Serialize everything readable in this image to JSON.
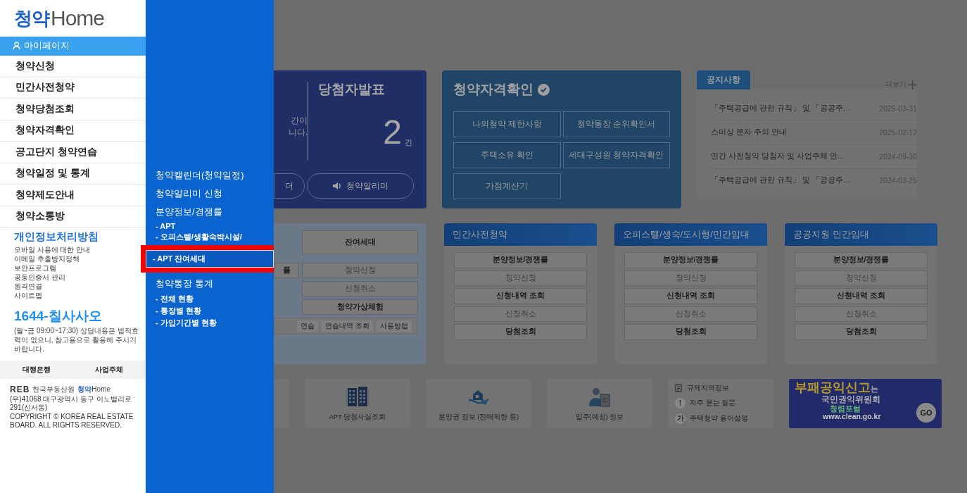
{
  "logo": {
    "mark": "청약",
    "word": "Home"
  },
  "sidebar": {
    "items": [
      {
        "label": "마이페이지",
        "selected": true
      },
      {
        "label": "청약신청",
        "selected": false
      },
      {
        "label": "민간사전청약",
        "selected": false
      },
      {
        "label": "청약당첨조회",
        "selected": false
      },
      {
        "label": "청약자격확인",
        "selected": false
      },
      {
        "label": "공고단지 청약연습",
        "selected": false
      },
      {
        "label": "청약일정 및 통계",
        "selected": false
      },
      {
        "label": "청약제도안내",
        "selected": false
      },
      {
        "label": "청약소통방",
        "selected": false
      }
    ]
  },
  "policy": {
    "title": "개인정보처리방침",
    "items": [
      "모바일 사용에 대한 안내",
      "이메일 추출방지정책",
      "보안프로그램",
      "공동인증서 관리",
      "원격연결",
      "사이트맵"
    ]
  },
  "hotline": {
    "number": "1644-칠사사오",
    "note": "(월~금 09:00~17:30) 상담내용은 법적효력이 없으니, 참고용으로 활용해 주시기 바랍니다."
  },
  "footer_tabs": [
    "대행은행",
    "사업주체"
  ],
  "footer": {
    "logo_text": "REB",
    "org": "한국부동산원",
    "brand_mark": "청약",
    "brand_word": "Home",
    "address": "(우)41068 대구광역시 동구 이노밸리로 291(신서동)",
    "copyright": "COPYRIGHT © KOREA REAL ESTATE BOARD. ALL RIGHTS RESERVED."
  },
  "submenu": {
    "items": [
      {
        "label": "청약캘린더(청약일정)",
        "kind": "heading",
        "highlighted": false
      },
      {
        "label": "청약알리미 신청",
        "kind": "heading",
        "highlighted": false
      },
      {
        "label": "분양정보/경쟁률",
        "kind": "heading",
        "highlighted": false
      },
      {
        "label": "- APT",
        "kind": "sub",
        "highlighted": false
      },
      {
        "label": "- 오피스텔/생활숙박시설/",
        "kind": "sub",
        "highlighted": false
      },
      {
        "label": "- APT 잔여세대",
        "kind": "sub",
        "highlighted": true
      },
      {
        "label": "청약통장 통계",
        "kind": "heading",
        "highlighted": false
      },
      {
        "label": "- 전체 현황",
        "kind": "sub",
        "highlighted": false
      },
      {
        "label": "- 통장별 현황",
        "kind": "sub",
        "highlighted": false
      },
      {
        "label": "- 가입기간별 현황",
        "kind": "sub",
        "highlighted": false
      }
    ]
  },
  "announcement": {
    "fragment_lines": [
      "간이",
      "니다."
    ],
    "title": "당첨자발표",
    "count": "2",
    "unit": "건",
    "buttons": [
      {
        "label": "더",
        "kind": "plain"
      },
      {
        "label": "청약알리미",
        "kind": "speaker"
      }
    ]
  },
  "eligibility": {
    "title": "청약자격확인",
    "buttons": [
      "나의청약 제한사항",
      "청약통장 순위확인서",
      "주택소유 확인",
      "세대구성원 청약자격확인",
      "가점계산기"
    ]
  },
  "notices": {
    "title": "공지사항",
    "more": "더보기",
    "items": [
      {
        "title": "「주택공급에 관한 규칙」 및 「공공주…",
        "date": "2025-03-31"
      },
      {
        "title": "스미싱 문자 주의 안내",
        "date": "2025-02-12"
      },
      {
        "title": "민간 사전청약 당첨자 및 사업주체 안…",
        "date": "2024-09-30"
      },
      {
        "title": "「주택공급에 관한 규칙」 및 「공공주…",
        "date": "2024-03-25"
      }
    ]
  },
  "apt_card": {
    "rows": [
      {
        "right": {
          "label": "잔여세대",
          "disabled": false
        }
      },
      {
        "left": "률",
        "right": {
          "label": "청약신청",
          "disabled": true
        }
      },
      {
        "right": {
          "label": "신청취소",
          "disabled": true
        }
      },
      {
        "right": {
          "label": "청약가상체험",
          "disabled": false
        }
      }
    ],
    "chips": [
      "연습",
      "연습내역 조회",
      "사용방법"
    ]
  },
  "service_cards": [
    {
      "title": "민간사전청약",
      "buttons": [
        {
          "label": "분양정보/경쟁률",
          "disabled": false
        },
        {
          "label": "청약신청",
          "disabled": true
        },
        {
          "label": "신청내역 조회",
          "disabled": false
        },
        {
          "label": "신청취소",
          "disabled": true
        },
        {
          "label": "당첨조회",
          "disabled": false
        }
      ]
    },
    {
      "title": "오피스텔/생숙/도시형/민간임대",
      "buttons": [
        {
          "label": "분양정보/경쟁률",
          "disabled": false
        },
        {
          "label": "청약신청",
          "disabled": true
        },
        {
          "label": "신청내역 조회",
          "disabled": false
        },
        {
          "label": "신청취소",
          "disabled": true
        },
        {
          "label": "당첨조회",
          "disabled": false
        }
      ]
    },
    {
      "title": "공공지원 민간임대",
      "buttons": [
        {
          "label": "분양정보/경쟁률",
          "disabled": false
        },
        {
          "label": "청약신청",
          "disabled": true
        },
        {
          "label": "신청내역 조회",
          "disabled": false
        },
        {
          "label": "신청취소",
          "disabled": true
        },
        {
          "label": "당첨조회",
          "disabled": false
        }
      ]
    }
  ],
  "shortcuts": [
    {
      "label": "APT 당첨사실조회",
      "kind": "building"
    },
    {
      "label": "분양권 정보 (전매제한 등)",
      "kind": "hand-house"
    },
    {
      "label": "입주(예정) 정보",
      "kind": "person-doc"
    }
  ],
  "quick_links": [
    {
      "label": "규제지역정보",
      "kind": "icon"
    },
    {
      "label": "자주 묻는 질문",
      "kind": "glyph",
      "glyph": "!"
    },
    {
      "label": "주택청약 용어설명",
      "kind": "glyph",
      "glyph": "가"
    }
  ],
  "banner": {
    "headline": "부패공익신고",
    "particle": "는",
    "org": "국민권익위원회",
    "portal": "청렴포털",
    "url": "www.clean.go.kr",
    "go": "GO"
  }
}
